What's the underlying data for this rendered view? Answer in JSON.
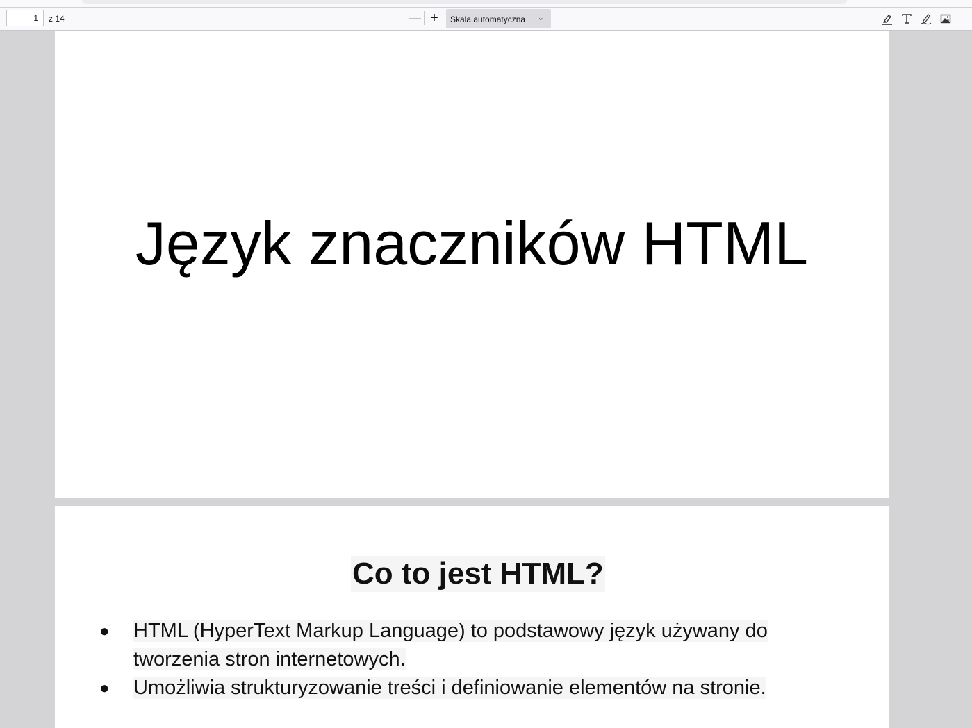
{
  "toolbar": {
    "page_number": "1",
    "page_count": "z 14",
    "zoom_out": "—",
    "zoom_in": "+",
    "scale_select": "Skala automatyczna",
    "tools": [
      "highlight-icon",
      "text-icon",
      "draw-icon",
      "image-icon"
    ]
  },
  "pages": {
    "p1_title": "Język znaczników HTML",
    "p2_heading": "Co to jest HTML?",
    "p2_bullets": [
      "HTML (HyperText Markup Language) to podstawowy język używany do tworzenia stron internetowych.",
      "Umożliwia strukturyzowanie treści i definiowanie elementów na stronie."
    ],
    "bullet_char": "●"
  }
}
